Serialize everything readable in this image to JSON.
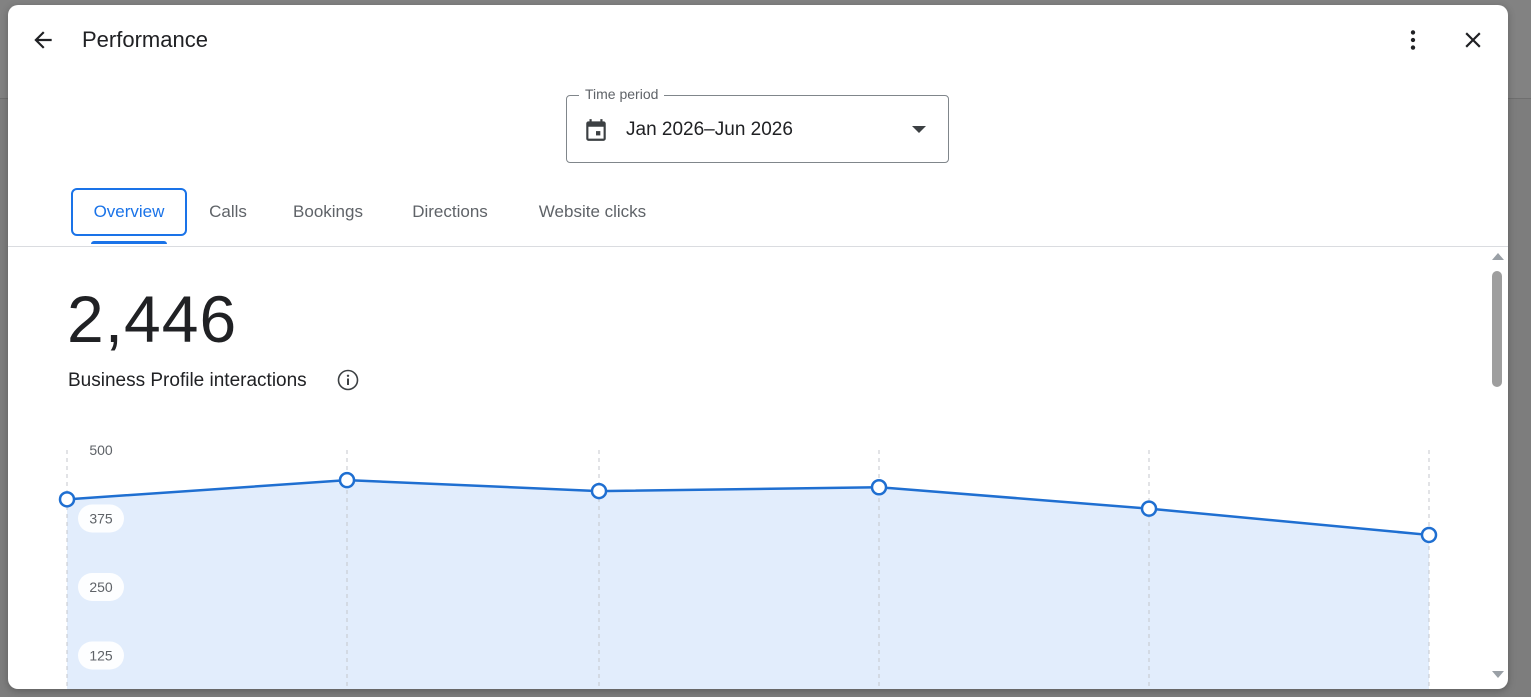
{
  "dialog": {
    "title": "Performance",
    "icons": {
      "back": "arrow-back-icon",
      "more": "more-vert-icon",
      "close": "close-icon"
    }
  },
  "time_period": {
    "label": "Time period",
    "value": "Jan 2026–Jun 2026",
    "icon": "calendar-icon"
  },
  "tabs": [
    {
      "label": "Overview",
      "active": true
    },
    {
      "label": "Calls",
      "active": false
    },
    {
      "label": "Bookings",
      "active": false
    },
    {
      "label": "Directions",
      "active": false
    },
    {
      "label": "Website clicks",
      "active": false
    }
  ],
  "metric": {
    "value": "2,446",
    "label": "Business Profile interactions",
    "info_icon": "info-icon"
  },
  "colors": {
    "accent": "#1a73e8",
    "line": "#1f6fd1",
    "area": "#e2edfc",
    "text": "#202124",
    "muted": "#5f6368"
  },
  "chart_data": {
    "type": "area",
    "x": [
      1,
      2,
      3,
      4,
      5,
      6
    ],
    "y_ticks": [
      "500",
      "375",
      "250",
      "125"
    ],
    "ylim": [
      0,
      500
    ],
    "series": [
      {
        "values": [
          410,
          445,
          425,
          432,
          393,
          345
        ]
      }
    ],
    "grid": "vertical-dashed"
  }
}
